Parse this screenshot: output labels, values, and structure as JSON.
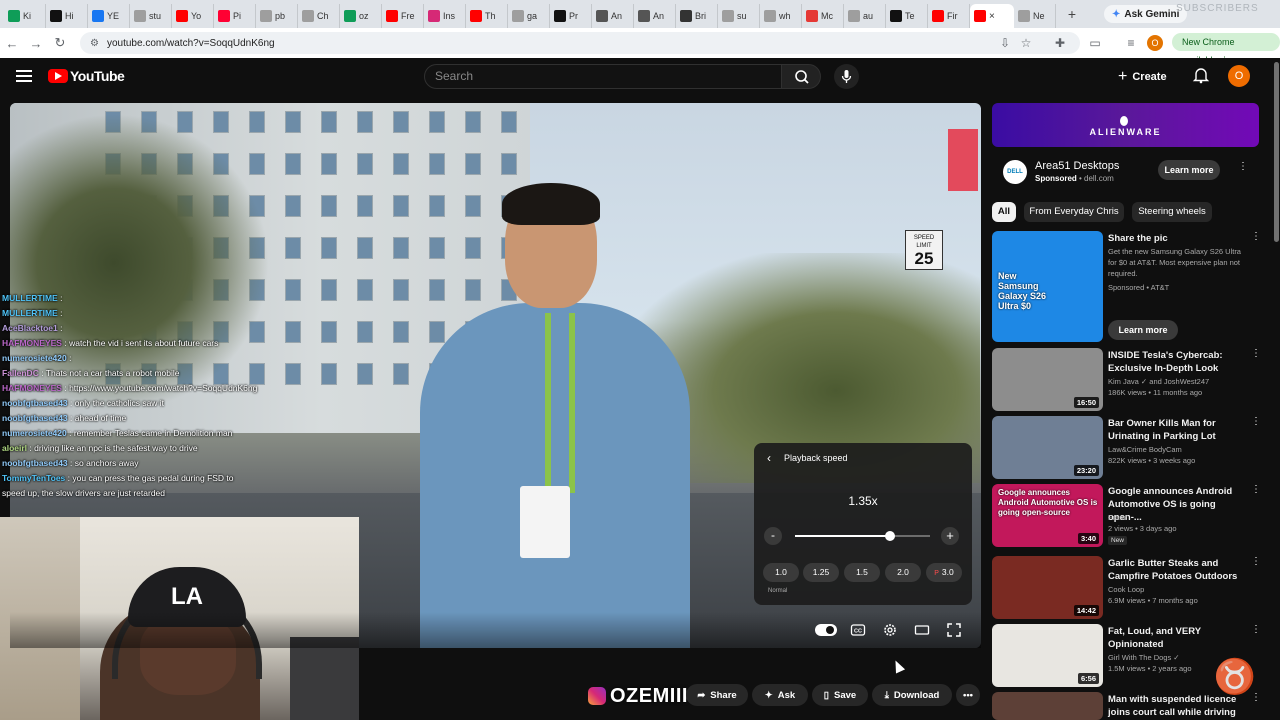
{
  "browser": {
    "tabs": [
      {
        "label": "Ki",
        "color": "#0f9d58"
      },
      {
        "label": "Hi",
        "color": "#111111"
      },
      {
        "label": "YE",
        "color": "#1877f2"
      },
      {
        "label": "stu",
        "color": "#9e9e9e"
      },
      {
        "label": "Yo",
        "color": "#ff0000"
      },
      {
        "label": "Pi",
        "color": "#ff0033"
      },
      {
        "label": "pb",
        "color": "#9e9e9e"
      },
      {
        "label": "Ch",
        "color": "#9e9e9e"
      },
      {
        "label": "oz",
        "color": "#0f9d58"
      },
      {
        "label": "Fre",
        "color": "#ff0000"
      },
      {
        "label": "Ins",
        "color": "#d62976"
      },
      {
        "label": "Th",
        "color": "#ff0000"
      },
      {
        "label": "ga",
        "color": "#9e9e9e"
      },
      {
        "label": "Pr",
        "color": "#111111"
      },
      {
        "label": "An",
        "color": "#555555"
      },
      {
        "label": "An",
        "color": "#555555"
      },
      {
        "label": "Bri",
        "color": "#333333"
      },
      {
        "label": "su",
        "color": "#9e9e9e"
      },
      {
        "label": "wh",
        "color": "#9e9e9e"
      },
      {
        "label": "Mc",
        "color": "#e53935"
      },
      {
        "label": "au",
        "color": "#9e9e9e"
      },
      {
        "label": "Te",
        "color": "#111111"
      },
      {
        "label": "Fir",
        "color": "#ff0000"
      }
    ],
    "active_tab_label": "",
    "next_tab_label": "Ne",
    "new_tab_symbol": "+",
    "gemini_label": "Ask Gemini",
    "overlay_text": "SUBSCRIBERS",
    "url": "youtube.com/watch?v=SoqqUdnK6ng",
    "profile_letter": "O",
    "new_chrome_label": "New Chrome available"
  },
  "youtube": {
    "logo_text": "YouTube",
    "search_placeholder": "Search",
    "create_label": "Create",
    "avatar_letter": "O"
  },
  "video": {
    "speed_sign_top": "SPEED LIMIT",
    "speed_sign_value": "25"
  },
  "chat": [
    {
      "user": "MULLERTIME",
      "msg": "",
      "color": "#4fc3f7"
    },
    {
      "user": "MULLERTIME",
      "msg": "",
      "color": "#4fc3f7"
    },
    {
      "user": "AceBlacktoe1",
      "msg": "",
      "color": "#b39ddb"
    },
    {
      "user": "HAFMONEYES",
      "msg": "watch the vid i sent its about future cars",
      "color": "#ba68c8"
    },
    {
      "user": "numerosiete420",
      "msg": "",
      "color": "#90caf9"
    },
    {
      "user": "FallenDC",
      "msg": "Thats not a car thats a robot mobile",
      "color": "#ce93d8"
    },
    {
      "user": "HAFMONEYES",
      "msg": "https://www.youtube.com/watch?v=SoqqUdnK6ng",
      "color": "#ba68c8"
    },
    {
      "user": "noobfgtbased43",
      "msg": "only the catholics saw it",
      "color": "#90caf9"
    },
    {
      "user": "noobfgtbased43",
      "msg": "ahead of time",
      "color": "#90caf9"
    },
    {
      "user": "numerosiete420",
      "msg": "remember Teslas came in Demolition man",
      "color": "#90caf9"
    },
    {
      "user": "aloeirl",
      "msg": "driving like an npc is the safest way to drive",
      "color": "#aed581"
    },
    {
      "user": "noobfgtbased43",
      "msg": "so anchors away",
      "color": "#90caf9"
    },
    {
      "user": "TommyTenToes",
      "msg": "you can press the gas pedal during FSD to",
      "color": "#4fc3f7"
    },
    {
      "user": "",
      "msg": "speed up, the slow drivers are just retarded",
      "color": "#ffffff"
    }
  ],
  "webcam": {
    "cap_text": "LA"
  },
  "speed_panel": {
    "title": "Playback speed",
    "value_label": "1.35x",
    "value": 1.35,
    "min": 0.25,
    "max": 4.0,
    "minus": "-",
    "plus": "+",
    "presets": [
      "1.0",
      "1.25",
      "1.5",
      "2.0",
      "3.0"
    ],
    "normal_label": "Normal",
    "premium_tag": "P"
  },
  "actions": {
    "watermark": "OZEMIII",
    "share": "Share",
    "ask": "Ask",
    "save": "Save",
    "download": "Download"
  },
  "ad": {
    "brand": "ALIENWARE",
    "logo": "DELL",
    "title": "Area51 Desktops",
    "sponsored": "Sponsored",
    "domain": "dell.com",
    "cta": "Learn more"
  },
  "chips": [
    "All",
    "From Everyday Chris",
    "Steering wheels"
  ],
  "recommendations": [
    {
      "title": "Share the pic",
      "meta1": "Get the new Samsung Galaxy S26 Ultra for $0 at AT&T. Most expensive plan not required.",
      "meta2": "Sponsored • AT&T",
      "duration": "",
      "thumb": "#1e88e5",
      "cta": "Learn more",
      "thumb_text": "New Samsung Galaxy S26 Ultra $0"
    },
    {
      "title": "INSIDE Tesla's Cybercab: Exclusive In-Depth Look",
      "meta1": "Kim Java ✓ and JoshWest247",
      "meta2": "186K views • 11 months ago",
      "duration": "16:50",
      "thumb": "#8d8d8d"
    },
    {
      "title": "Bar Owner Kills Man for Urinating in Parking Lot",
      "meta1": "Law&Crime BodyCam",
      "meta2": "822K views • 3 weeks ago",
      "duration": "23:20",
      "thumb": "#6f7f95"
    },
    {
      "title": "Google announces Android Automotive OS is going open-...",
      "meta1": "Franz",
      "meta2": "2 views • 3 days ago",
      "duration": "3:40",
      "thumb": "#c2185b",
      "badge": "New",
      "thumb_text": "Google announces Android Automotive OS is going open-source"
    },
    {
      "title": "Garlic Butter Steaks and Campfire Potatoes Outdoors",
      "meta1": "Cook Loop",
      "meta2": "6.9M views • 7 months ago",
      "duration": "14:42",
      "thumb": "#7a2a22"
    },
    {
      "title": "Fat, Loud, and VERY Opinionated",
      "meta1": "Girl With The Dogs ✓",
      "meta2": "1.5M views • 2 years ago",
      "duration": "6:56",
      "thumb": "#e8e6e1"
    },
    {
      "title": "Man with suspended licence joins court call while driving",
      "meta1": "",
      "meta2": "",
      "duration": "",
      "thumb": "#5d4037"
    }
  ]
}
